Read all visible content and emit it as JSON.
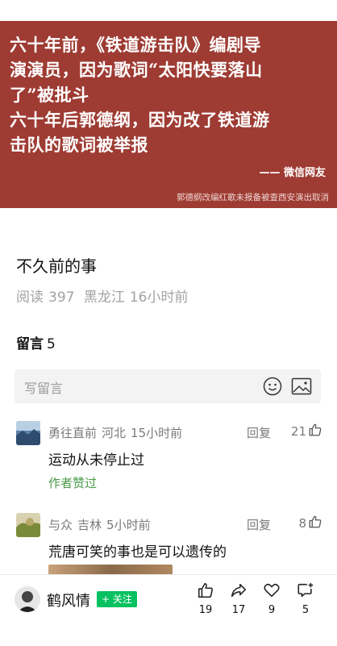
{
  "banner": {
    "lines": [
      "六十年前，《铁道游击队》编剧导",
      "演演员，因为歌词“太阳快要落山",
      "了”被批斗",
      "六十年后郭德纲，因为改了铁道游",
      "击队的歌词被举报"
    ],
    "source": "—— 微信网友",
    "caption": "郭德纲改编红歌未报备被查西安演出取消"
  },
  "article": {
    "title": "不久前的事",
    "read_label": "阅读",
    "read_count": "397",
    "location": "黑龙江",
    "time": "16小时前"
  },
  "comments_section": {
    "label": "留言",
    "count": "5",
    "input_placeholder": "写留言"
  },
  "comments": [
    {
      "name": "勇往直前",
      "location": "河北",
      "time": "15小时前",
      "reply_label": "回复",
      "likes": "21",
      "text": "运动从未停止过",
      "author_liked": "作者赞过"
    },
    {
      "name": "与众",
      "location": "吉林",
      "time": "5小时前",
      "reply_label": "回复",
      "likes": "8",
      "text": "荒唐可笑的事也是可以遗传的"
    }
  ],
  "bottom_bar": {
    "author_name": "鹤风情",
    "follow_label": "+ 关注",
    "like_count": "19",
    "share_count": "17",
    "heart_count": "9",
    "comment_count": "5"
  },
  "colors": {
    "banner_bg": "#9e3b33",
    "accent_green": "#07c160",
    "author_liked_green": "#4a9a4a"
  }
}
